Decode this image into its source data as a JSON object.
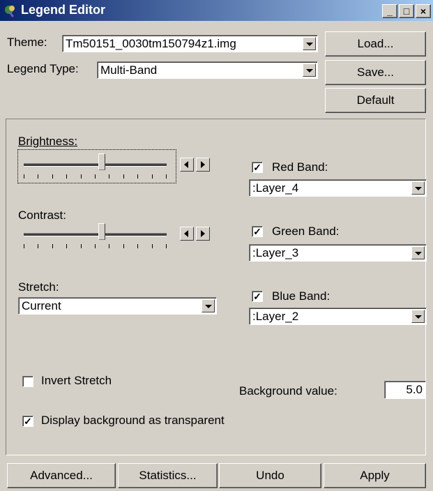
{
  "window": {
    "title": "Legend Editor",
    "icon": "legend-editor-icon",
    "controls": {
      "minimize": "_",
      "maximize": "□",
      "close": "×"
    }
  },
  "theme": {
    "label": "Theme:",
    "value": "Tm50151_0030tm150794z1.img"
  },
  "legend_type": {
    "label": "Legend Type:",
    "value": "Multi-Band"
  },
  "side_buttons": {
    "load": "Load...",
    "save": "Save...",
    "default": "Default"
  },
  "brightness": {
    "label": "Brightness:",
    "level": 0.55
  },
  "contrast": {
    "label": "Contrast:",
    "level": 0.55
  },
  "stretch": {
    "label": "Stretch:",
    "value": "Current"
  },
  "bands": {
    "red": {
      "label": "Red Band:",
      "checked": true,
      "value": ":Layer_4"
    },
    "green": {
      "label": "Green Band:",
      "checked": true,
      "value": ":Layer_3"
    },
    "blue": {
      "label": "Blue Band:",
      "checked": true,
      "value": ":Layer_2"
    }
  },
  "invert_stretch": {
    "label": "Invert Stretch",
    "checked": false
  },
  "background_value": {
    "label": "Background value:",
    "value": "5.0"
  },
  "display_transparent": {
    "label": "Display background as transparent",
    "checked": true
  },
  "bottom_buttons": {
    "advanced": "Advanced...",
    "statistics": "Statistics...",
    "undo": "Undo",
    "apply": "Apply"
  },
  "check_glyph": "✓"
}
